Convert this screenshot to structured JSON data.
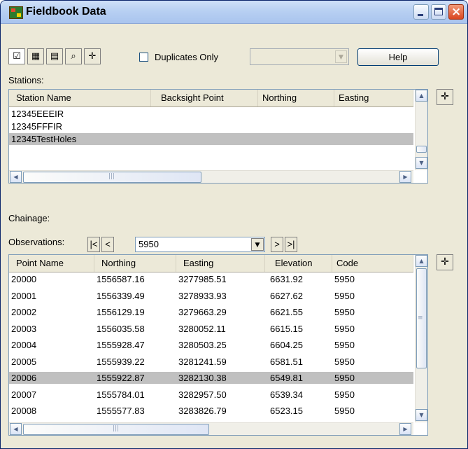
{
  "window": {
    "title": "Fieldbook Data"
  },
  "toolbar": {
    "tools": [
      {
        "name": "check-list-tool",
        "glyph": "☑"
      },
      {
        "name": "report-tool",
        "glyph": "▦"
      },
      {
        "name": "list-tool",
        "glyph": "▤"
      },
      {
        "name": "find-tool",
        "glyph": "⌕"
      },
      {
        "name": "zoom-tool",
        "glyph": "✛"
      }
    ],
    "duplicates_label": "Duplicates Only",
    "duplicates_checked": false,
    "help_label": "Help"
  },
  "stations": {
    "label": "Stations:",
    "columns": [
      "Station Name",
      "Backsight Point",
      "Northing",
      "Easting"
    ],
    "rows": [
      [
        "12345EEEIR",
        "",
        "",
        ""
      ],
      [
        "12345FFFIR",
        "",
        "",
        ""
      ],
      [
        "12345TestHoles",
        "",
        "",
        ""
      ]
    ],
    "selected_row": 2
  },
  "chainage": {
    "label": "Chainage:",
    "value": "5950",
    "first": "|<",
    "prev": "<",
    "next": ">",
    "last": ">|"
  },
  "observations": {
    "label": "Observations:",
    "columns": [
      "Point Name",
      "Northing",
      "Easting",
      "Elevation",
      "Code"
    ],
    "rows": [
      [
        "20000",
        "1556587.16",
        "3277985.51",
        "6631.92",
        "5950"
      ],
      [
        "20001",
        "1556339.49",
        "3278933.93",
        "6627.62",
        "5950"
      ],
      [
        "20002",
        "1556129.19",
        "3279663.29",
        "6621.55",
        "5950"
      ],
      [
        "20003",
        "1556035.58",
        "3280052.11",
        "6615.15",
        "5950"
      ],
      [
        "20004",
        "1555928.47",
        "3280503.25",
        "6604.25",
        "5950"
      ],
      [
        "20005",
        "1555939.22",
        "3281241.59",
        "6581.51",
        "5950"
      ],
      [
        "20006",
        "1555922.87",
        "3282130.38",
        "6549.81",
        "5950"
      ],
      [
        "20007",
        "1555784.01",
        "3282957.50",
        "6539.34",
        "5950"
      ],
      [
        "20008",
        "1555577.83",
        "3283826.79",
        "6523.15",
        "5950"
      ]
    ],
    "selected_row": 6
  },
  "icons": {
    "scroll_up": "▲",
    "scroll_down": "▼",
    "scroll_left": "◀",
    "scroll_right": "▶",
    "pin": "✛",
    "dropdown": "▼",
    "grip": "|||"
  }
}
